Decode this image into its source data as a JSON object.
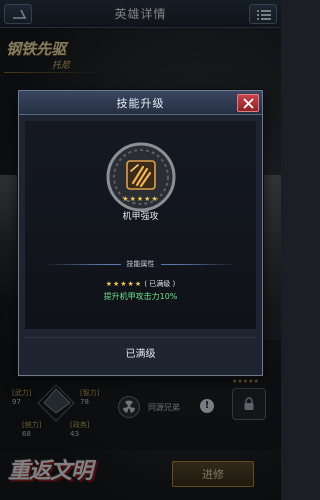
{
  "header": {
    "title": "英雄详情"
  },
  "hero": {
    "name": "钢铁先驱",
    "subtitle": "托尼"
  },
  "stats": {
    "force_label": "[武力]",
    "force_value": "97",
    "wisdom_label": "[智力]",
    "wisdom_value": "78",
    "command_label": "[统力]",
    "command_value": "68",
    "politics_label": "[政务]",
    "politics_value": "43"
  },
  "bond": {
    "label": "同源兄弟",
    "info": "!"
  },
  "slot_stars": "★★★★★",
  "logo_text": "重返文明",
  "upgrade_button": "进修",
  "dialog": {
    "title": "技能升级",
    "skill_stars": "★★★★★",
    "skill_name": "机甲强攻",
    "section_label": "技能属性",
    "attr_stars": "★★★★★",
    "attr_status": "( 已满级 )",
    "attr_desc": "提升机甲攻击力10%",
    "footer_status": "已满级"
  },
  "colors": {
    "accent_gold": "#f0c65e",
    "positive_green": "#6fe08a",
    "close_red": "#c8444a",
    "panel_blue": "#263044"
  },
  "icons": [
    "back-arrow-icon",
    "menu-list-icon",
    "close-icon",
    "skill-claw-icon",
    "radiation-icon",
    "lock-icon",
    "info-icon"
  ]
}
